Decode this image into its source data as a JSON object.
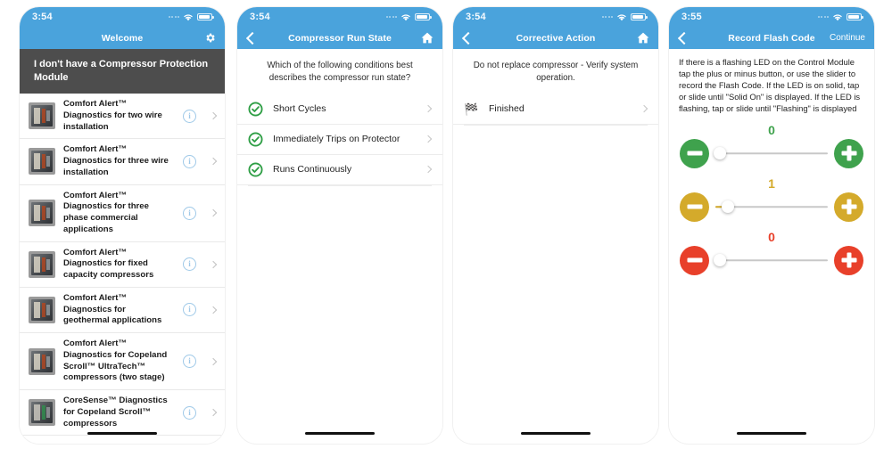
{
  "theme": {
    "blue": "#4aa3dc",
    "dark_banner": "#4d4d4d",
    "green": "#3fa24d",
    "yellow": "#d4aa2b",
    "red": "#e8402a",
    "info_blue": "#9fc9e8"
  },
  "screen1": {
    "status": {
      "time": "3:54"
    },
    "nav": {
      "title": "Welcome",
      "right_icon": "gear-icon"
    },
    "banner": "I don't have a Compressor Protection Module",
    "items": [
      {
        "label": "Comfort Alert™ Diagnostics for two wire installation",
        "info": "i",
        "thumb": "module-photo"
      },
      {
        "label": "Comfort Alert™ Diagnostics for three wire installation",
        "info": "i",
        "thumb": "module-photo"
      },
      {
        "label": "Comfort Alert™ Diagnostics for three phase commercial applications",
        "info": "i",
        "thumb": "module-photo"
      },
      {
        "label": "Comfort Alert™ Diagnostics for fixed capacity compressors",
        "info": "i",
        "thumb": "module-photo"
      },
      {
        "label": "Comfort Alert™ Diagnostics for geothermal applications",
        "info": "i",
        "thumb": "module-photo"
      },
      {
        "label": "Comfort Alert™ Diagnostics for Copeland Scroll™ UltraTech™ compressors (two stage)",
        "info": "i",
        "thumb": "module-photo"
      },
      {
        "label": "CoreSense™ Diagnostics for Copeland Scroll™ compressors",
        "info": "i",
        "thumb": "coresense-photo"
      }
    ]
  },
  "screen2": {
    "status": {
      "time": "3:54"
    },
    "nav": {
      "title": "Compressor Run State",
      "left_icon": "back-chevron-icon",
      "right_icon": "home-icon"
    },
    "question": "Which of the following conditions best describes the compressor run state?",
    "options": [
      {
        "label": "Short Cycles",
        "icon": "check-circle-icon"
      },
      {
        "label": "Immediately Trips on Protector",
        "icon": "check-circle-icon"
      },
      {
        "label": "Runs Continuously",
        "icon": "check-circle-icon"
      }
    ]
  },
  "screen3": {
    "status": {
      "time": "3:54"
    },
    "nav": {
      "title": "Corrective Action",
      "left_icon": "back-chevron-icon",
      "right_icon": "home-icon"
    },
    "question": "Do not replace compressor - Verify system operation.",
    "options": [
      {
        "label": "Finished",
        "icon": "checkered-flag-icon",
        "glyph": "🏁"
      }
    ]
  },
  "screen4": {
    "status": {
      "time": "3:55"
    },
    "nav": {
      "title": "Record Flash Code",
      "left_icon": "back-chevron-icon",
      "action": "Continue"
    },
    "instructions": "If there is a flashing LED on the Control Module tap the plus or minus button, or use the slider to record the Flash Code. If the LED is on solid, tap or slide until \"Solid On\" is displayed. If the LED is flashing, tap or slide until \"Flashing\" is displayed",
    "sliders": [
      {
        "name": "green",
        "value": "0",
        "color": "#3fa24d",
        "percent": 4,
        "minus": "minus-button",
        "plus": "plus-button"
      },
      {
        "name": "yellow",
        "value": "1",
        "color": "#d4aa2b",
        "percent": 11,
        "minus": "minus-button",
        "plus": "plus-button"
      },
      {
        "name": "red",
        "value": "0",
        "color": "#e8402a",
        "percent": 4,
        "minus": "minus-button",
        "plus": "plus-button"
      }
    ]
  }
}
